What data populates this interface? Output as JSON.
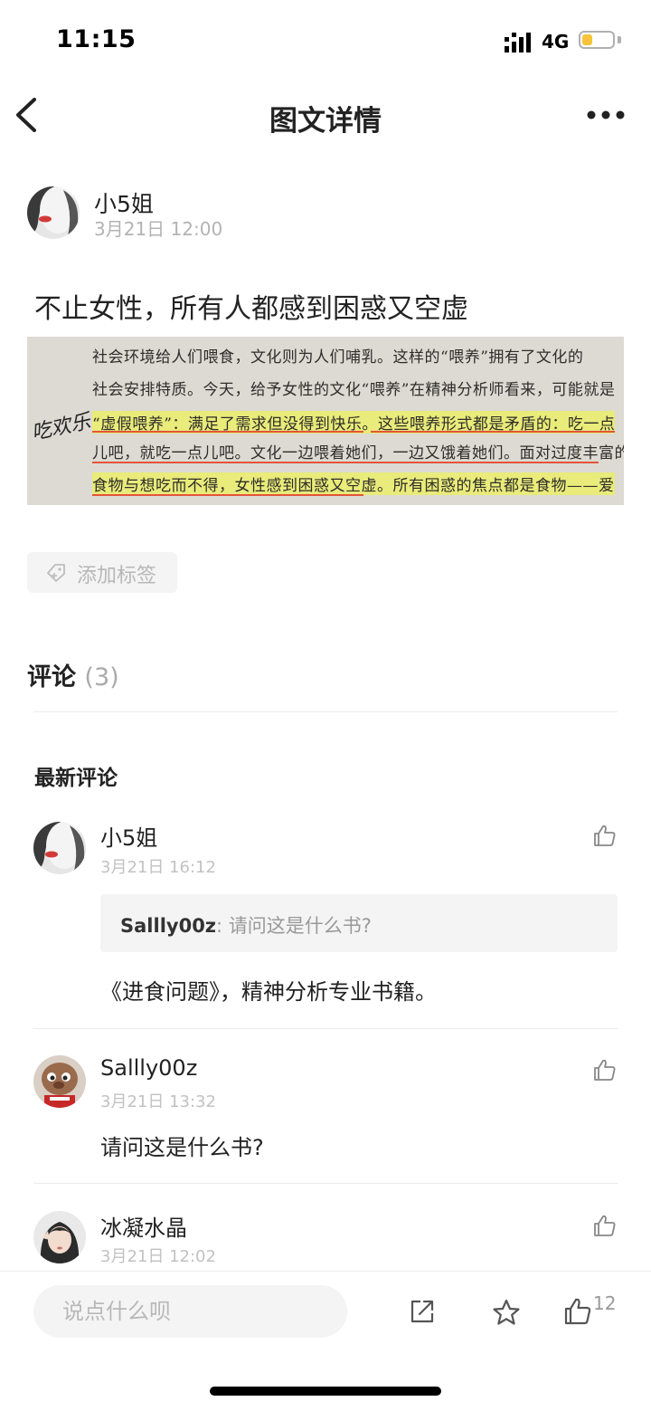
{
  "status_bar": {
    "time": "11:15",
    "network": "4G",
    "battery_level": 0.35,
    "battery_color": "#f6c33b"
  },
  "nav": {
    "title": "图文详情",
    "back_icon": "chevron-left-icon",
    "more_icon": "more-dots-icon"
  },
  "author": {
    "name": "小5姐",
    "time": "3月21日 12:00"
  },
  "post": {
    "title": "不止女性，所有人都感到困惑又空虚",
    "image_text": {
      "lines": [
        "社会环境给人们喂食，文化则为人们哺乳。这样的“喂养”拥有了文化的",
        "社会安排特质。今天，给予女性的文化“喂养”在精神分析师看来，可能就是",
        "“虚假喂养”：满足了需求但没得到快乐。这些喂养形式都是矛盾的：吃一点",
        "儿吧，就吃一点儿吧。文化一边喂着她们，一边又饿着她们。面对过度丰富的",
        "食物与想吃而不得，女性感到困惑又空虚。所有困惑的焦点都是食物——爱"
      ],
      "handwriting": "吃欢乐"
    }
  },
  "tag": {
    "label": "添加标签",
    "icon": "tag-add-icon"
  },
  "comments": {
    "title": "评论",
    "count": "(3)",
    "latest_label": "最新评论",
    "items": [
      {
        "name": "小5姐",
        "time": "3月21日 16:12",
        "quote_user": "Sallly00z",
        "quote_text": ": 请问这是什么书?",
        "text": "《进食问题》，精神分析专业书籍。"
      },
      {
        "name": "Sallly00z",
        "time": "3月21日 13:32",
        "text": "请问这是什么书?"
      },
      {
        "name": "冰凝水晶",
        "time": "3月21日 12:02"
      }
    ]
  },
  "bottom_bar": {
    "input_placeholder": "说点什么呗",
    "like_count": "12",
    "share_icon": "share-icon",
    "favorite_icon": "star-icon",
    "like_icon": "thumbs-up-icon"
  }
}
